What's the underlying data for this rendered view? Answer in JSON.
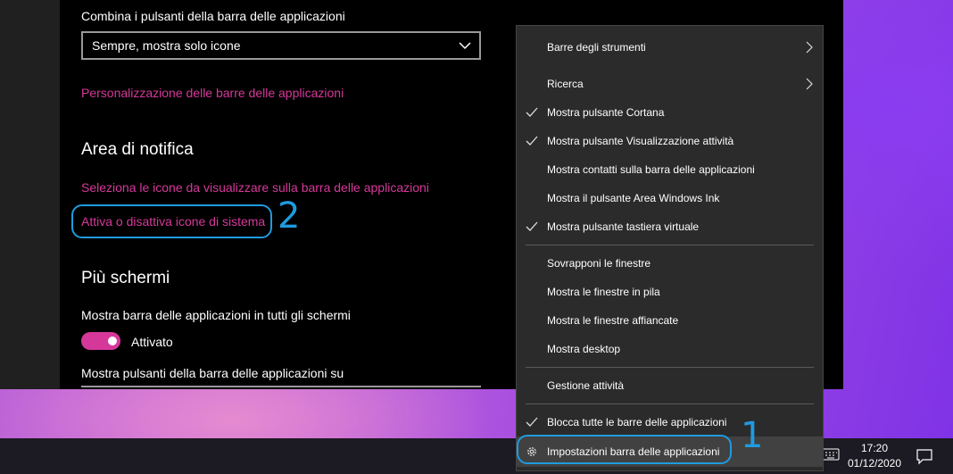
{
  "settings": {
    "combine_label": "Combina i pulsanti della barra delle applicazioni",
    "combine_value": "Sempre, mostra solo icone",
    "customize_link": "Personalizzazione delle barre delle applicazioni",
    "notification_heading": "Area di notifica",
    "select_icons_link": "Seleziona le icone da visualizzare sulla barra delle applicazioni",
    "system_icons_link": "Attiva o disattiva icone di sistema",
    "multi_heading": "Più schermi",
    "show_all_label": "Mostra barra delle applicazioni in tutti gli schermi",
    "show_all_toggle": "Attivato",
    "show_buttons_label": "Mostra pulsanti della barra delle applicazioni su"
  },
  "annotations": {
    "one": "1",
    "two": "2"
  },
  "menu": {
    "items": [
      {
        "label": "Barre degli strumenti",
        "checked": false,
        "submenu": true
      },
      {
        "label": "Ricerca",
        "checked": false,
        "submenu": true
      },
      {
        "label": "Mostra pulsante Cortana",
        "checked": true,
        "submenu": false
      },
      {
        "label": "Mostra pulsante Visualizzazione attività",
        "checked": true,
        "submenu": false
      },
      {
        "label": "Mostra contatti sulla barra delle applicazioni",
        "checked": false,
        "submenu": false
      },
      {
        "label": "Mostra il pulsante Area Windows Ink",
        "checked": false,
        "submenu": false
      },
      {
        "label": "Mostra pulsante tastiera virtuale",
        "checked": true,
        "submenu": false
      },
      {
        "label": "Sovrapponi le finestre",
        "checked": false,
        "submenu": false
      },
      {
        "label": "Mostra le finestre in pila",
        "checked": false,
        "submenu": false
      },
      {
        "label": "Mostra le finestre affiancate",
        "checked": false,
        "submenu": false
      },
      {
        "label": "Mostra desktop",
        "checked": false,
        "submenu": false
      },
      {
        "label": "Gestione attività",
        "checked": false,
        "submenu": false
      },
      {
        "label": "Blocca tutte le barre delle applicazioni",
        "checked": true,
        "submenu": false
      },
      {
        "label": "Impostazioni barra delle applicazioni",
        "checked": false,
        "submenu": false,
        "icon": "gear-icon"
      }
    ]
  },
  "taskbar": {
    "time": "17:20",
    "date": "01/12/2020"
  },
  "colors": {
    "accent": "#d6389a",
    "annotation": "#1f9be0",
    "menu_bg": "#2b2b2b"
  }
}
